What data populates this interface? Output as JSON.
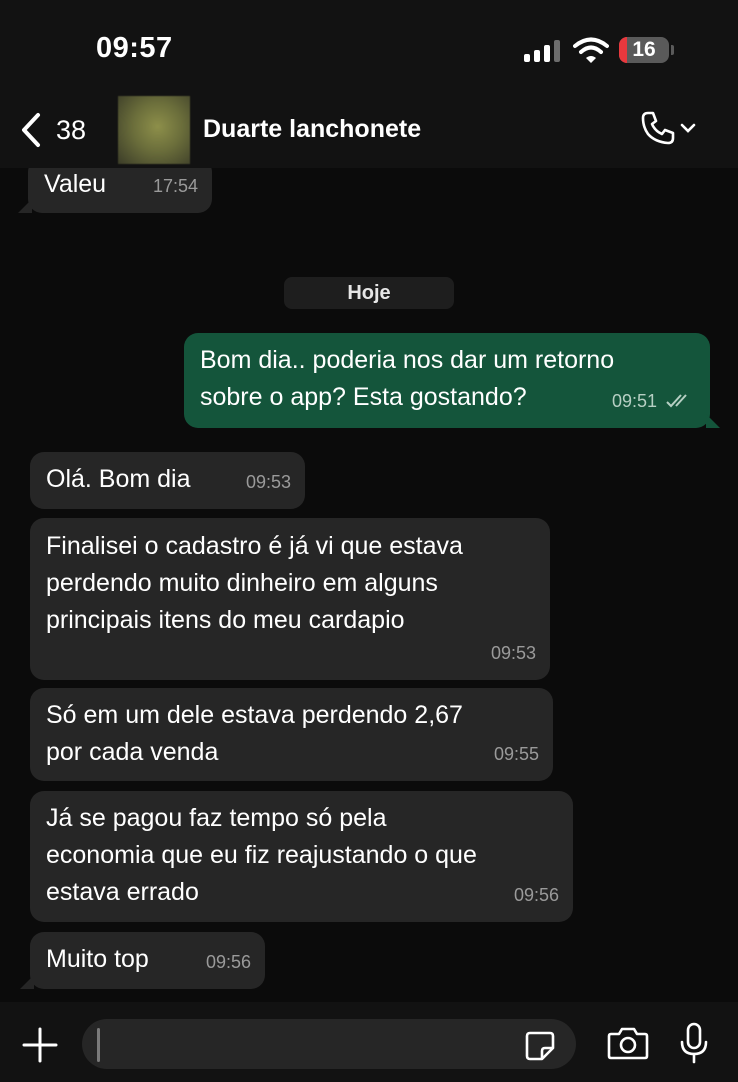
{
  "status_bar": {
    "time": "09:57",
    "battery": "16",
    "battery_level": 0.16,
    "icons": [
      "signal-icon",
      "wifi-icon",
      "battery-icon"
    ]
  },
  "header": {
    "back_count": "38",
    "contact_name": "Duarte lanchonete",
    "icons": [
      "chevron-left-icon",
      "phone-icon",
      "chevron-down-icon"
    ]
  },
  "date_divider": "Hoje",
  "messages": [
    {
      "direction": "in",
      "text": "Valeu",
      "time": "17:54"
    },
    {
      "direction": "out",
      "text": "Bom dia.. poderia nos dar um retorno\nsobre o app? Esta gostando?",
      "time": "09:51",
      "status": "read"
    },
    {
      "direction": "in",
      "text": "Olá. Bom dia",
      "time": "09:53"
    },
    {
      "direction": "in",
      "text": "Finalisei o cadastro é já vi que estava\nperdendo muito dinheiro em alguns\nprincipais itens do meu cardapio",
      "time": "09:53"
    },
    {
      "direction": "in",
      "text": "Só em um dele estava perdendo 2,67\npor cada venda",
      "time": "09:55"
    },
    {
      "direction": "in",
      "text": "Já se pagou faz tempo só pela\neconomia que eu fiz reajustando o que\nestava errado",
      "time": "09:56"
    },
    {
      "direction": "in",
      "text": "Muito top",
      "time": "09:56"
    }
  ],
  "composer": {
    "input_value": "",
    "icons": [
      "plus-icon",
      "sticker-icon",
      "camera-icon",
      "microphone-icon"
    ]
  },
  "colors": {
    "background": "#0b0b0b",
    "incoming_bubble": "#262626",
    "outgoing_bubble": "#14553b",
    "battery_low": "#e8383d"
  }
}
